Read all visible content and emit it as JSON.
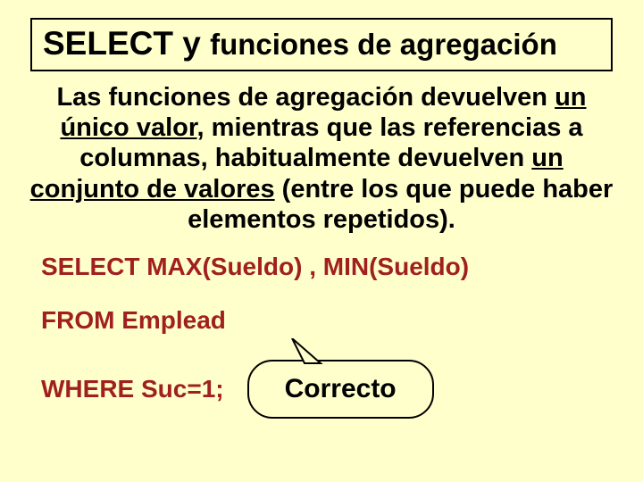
{
  "title": {
    "part1": "SELECT y ",
    "part2": "funciones de agregación"
  },
  "paragraph": {
    "p1": "Las funciones de agregación devuelven ",
    "u1": "un único valor",
    "p2": ", mientras que  las referencias a columnas, habitualmente devuelven ",
    "u2": "un conjunto de valores",
    "p3": " (entre los que puede haber elementos repetidos)."
  },
  "sql": {
    "line1": "SELECT MAX(Sueldo) , MIN(Sueldo)",
    "line2": "FROM Emplead",
    "line3": "WHERE Suc=1;"
  },
  "callout": {
    "text": "Correcto"
  }
}
